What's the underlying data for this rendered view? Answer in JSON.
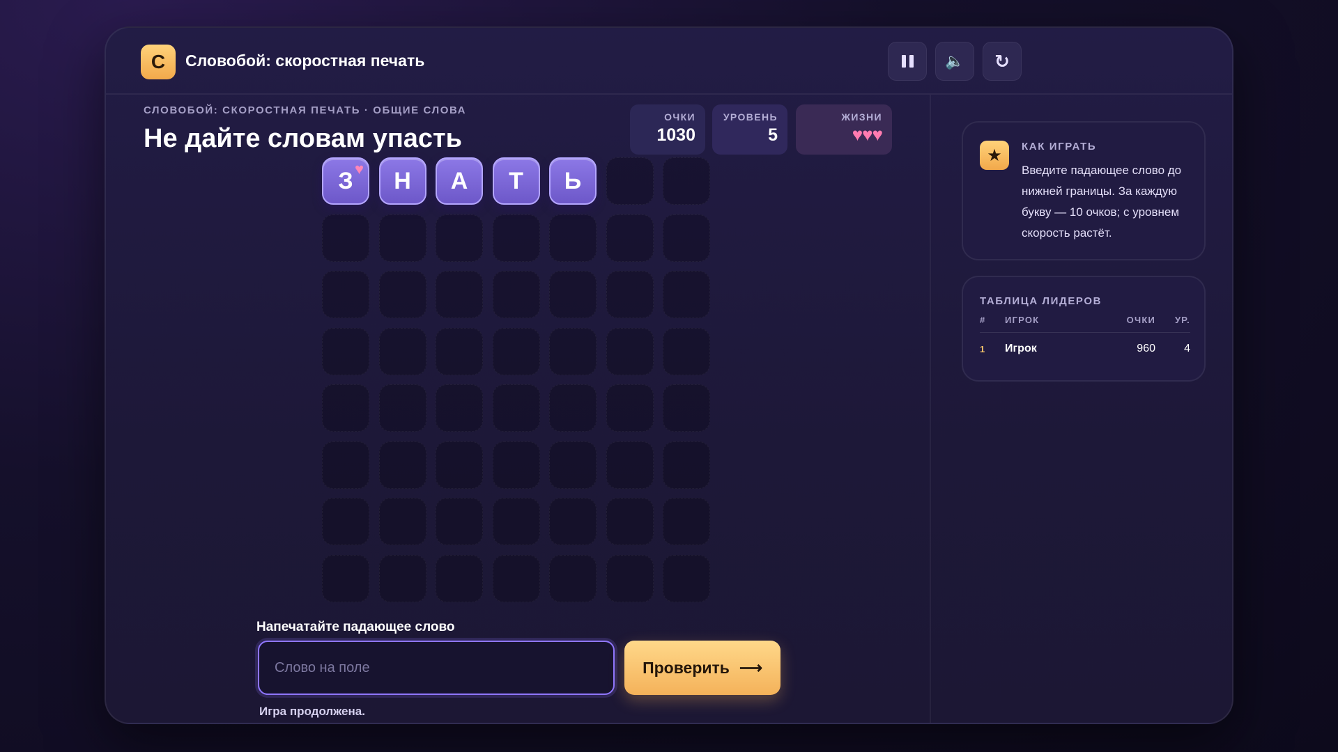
{
  "app": {
    "logo_letter": "С",
    "title": "Словобой: скоростная печать"
  },
  "toolbar": {
    "pause_icon": "pause-icon",
    "sound_icon": "sound-muted-icon",
    "sound_glyph": "🔈",
    "restart_icon": "restart-icon",
    "restart_glyph": "↻"
  },
  "header": {
    "eyebrow": "СЛОВОБОЙ: СКОРОСТНАЯ ПЕЧАТЬ · ОБЩИЕ СЛОВА",
    "headline": "Не дайте словам упасть"
  },
  "stats": {
    "score_label": "ОЧКИ",
    "score_value": "1030",
    "level_label": "УРОВЕНЬ",
    "level_value": "5",
    "lives_label": "ЖИЗНИ",
    "lives_count": 3,
    "lives_glyphs": "♥♥♥"
  },
  "board": {
    "columns": 7,
    "rows": 8,
    "falling_word": [
      "З",
      "Н",
      "А",
      "Т",
      "Ь"
    ],
    "falling_word_row": 0,
    "falling_word_start_col": 0,
    "bonus_heart_on_letter": 0,
    "heart_glyph": "♥"
  },
  "input": {
    "label": "Напечатайте падающее слово",
    "placeholder": "Слово на поле",
    "value": "",
    "submit_label": "Проверить",
    "submit_arrow": "⟶",
    "status": "Игра продолжена."
  },
  "howto": {
    "icon": "star-icon",
    "icon_glyph": "★",
    "title": "КАК ИГРАТЬ",
    "text": "Введите падающее слово до нижней границы. За каждую букву — 10 очков; с уровнем скорость растёт."
  },
  "leaderboard": {
    "title": "ТАБЛИЦА ЛИДЕРОВ",
    "columns": [
      "#",
      "ИГРОК",
      "ОЧКИ",
      "УР."
    ],
    "rows": [
      {
        "rank": "1",
        "player": "Игрок",
        "score": "960",
        "level": "4"
      }
    ]
  },
  "colors": {
    "accent": "#f4b25a",
    "tile": "#7a65d6",
    "heart": "#ff7bb0",
    "input_border": "#8f76ff"
  }
}
